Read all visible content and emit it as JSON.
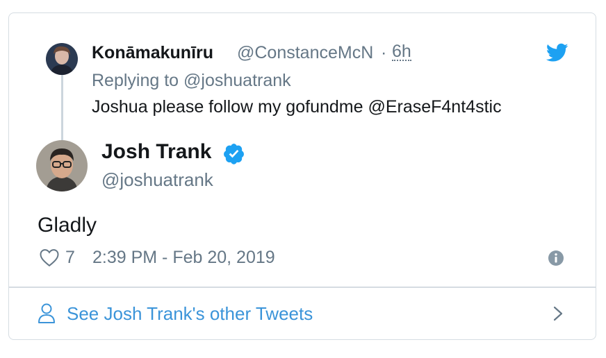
{
  "parent_tweet": {
    "display_name": "Konāmakunīru",
    "handle": "@ConstanceMcN",
    "separator": "·",
    "time": "6h",
    "replying_prefix": "Replying to",
    "replying_mention": "@joshuatrank",
    "text": "Joshua please follow my gofundme @EraseF4nt4stic"
  },
  "main_tweet": {
    "display_name": "Josh Trank",
    "handle": "@joshuatrank",
    "verified": true,
    "text": "Gladly",
    "like_count": "7",
    "timestamp": "2:39 PM - Feb 20, 2019"
  },
  "footer": {
    "link_text": "See Josh Trank's other Tweets"
  },
  "icons": {
    "brand": "twitter-bird-icon",
    "verified": "verified-badge-icon",
    "like": "heart-icon",
    "info": "info-icon",
    "person": "person-icon",
    "chevron": "chevron-right-icon"
  },
  "colors": {
    "twitter_blue": "#1da1f2",
    "link_blue": "#3b94d9",
    "secondary_text": "#657786",
    "primary_text": "#14171a",
    "border": "#d5dce2"
  }
}
